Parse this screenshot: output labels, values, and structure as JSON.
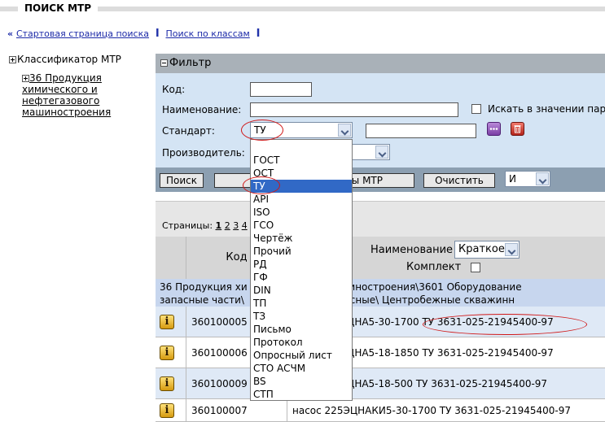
{
  "header": {
    "title": "ПОИСК МТР"
  },
  "nav": {
    "marker": "«",
    "start_link": "Стартовая страница поиска",
    "sep": "I",
    "class_link": "Поиск по классам"
  },
  "tree": {
    "root": "Классификатор МТР",
    "child_line1": "36 Продукция",
    "child_line2": "химического и",
    "child_line3": "нефтегазового",
    "child_line4": "машиностроения"
  },
  "filter": {
    "title": "Фильтр",
    "code_label": "Код:",
    "code_value": "",
    "name_label": "Наименование:",
    "name_value": "",
    "search_in_value_label": "Искать в значении пар",
    "standard_label": "Стандарт:",
    "standard_value": "ТУ",
    "standard_text_value": "",
    "manufacturer_label": "Производитель:",
    "search_button": "Поиск",
    "mtr_button_fragment": "ы МТР",
    "clear_button": "Очистить",
    "logic_value": "И"
  },
  "standard_options": [
    "ГОСТ",
    "ОСТ",
    "ТУ",
    "API",
    "ISO",
    "ГСО",
    "Чертёж",
    "Прочий",
    "РД",
    "ГФ",
    "DIN",
    "ТП",
    "ТЗ",
    "Письмо",
    "Протокол",
    "Опросный лист",
    "СТО АСЧМ",
    "BS",
    "СТП"
  ],
  "results": {
    "pages_label": "Страницы:",
    "pages": [
      "1",
      "2",
      "3",
      "4"
    ],
    "col_code": "Код",
    "col_name": "Наименование",
    "name_mode": "Краткое",
    "kit_label": "Комплект",
    "group_line1": "36 Продукция хи          газового машиностроения\\3601 Оборудование",
    "group_line2": "запасные части\\          агрегаты насосные\\ Центробежные скважинн",
    "rows": [
      {
        "code": "360100005",
        "name": "ЦНА5-30-1700  ТУ 3631-025-21945400-97"
      },
      {
        "code": "360100006",
        "name": "ЦНА5-18-1850  ТУ 3631-025-21945400-97"
      },
      {
        "code": "360100009",
        "name": "ЦНА5-18-500  ТУ 3631-025-21945400-97"
      },
      {
        "code": "360100007",
        "name": "насос 225ЭЦНАКИ5-30-1700  ТУ 3631-025-21945400-97"
      }
    ]
  },
  "colors": {
    "accent_red": "#d01818",
    "link_blue": "#1c2aa8",
    "selection": "#3169c6"
  }
}
